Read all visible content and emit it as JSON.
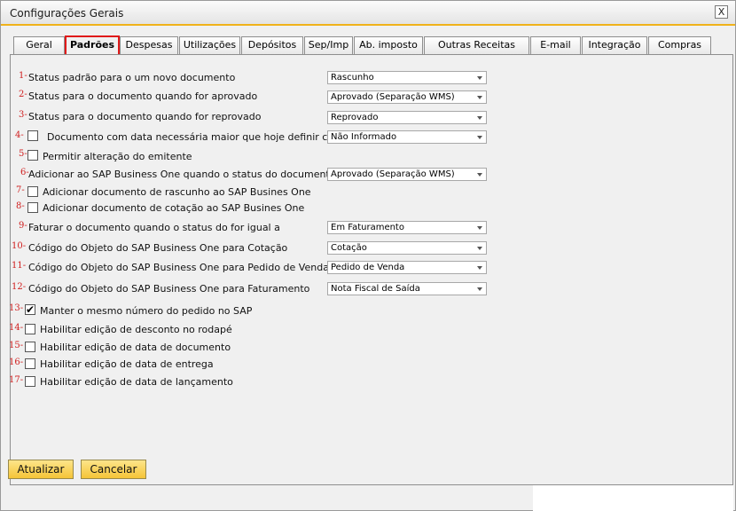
{
  "window": {
    "title": "Configurações Gerais",
    "close_label": "X"
  },
  "tabs": [
    {
      "label": "Geral"
    },
    {
      "label": "Padrões"
    },
    {
      "label": "Despesas"
    },
    {
      "label": "Utilizações"
    },
    {
      "label": "Depósitos"
    },
    {
      "label": "Sep/Imp"
    },
    {
      "label": "Ab. imposto"
    },
    {
      "label": "Outras Receitas"
    },
    {
      "label": "E-mail"
    },
    {
      "label": "Integração"
    },
    {
      "label": "Compras"
    }
  ],
  "rows": [
    {
      "num": "1-",
      "label": "Status padrão para o um novo documento",
      "value": "Rascunho"
    },
    {
      "num": "2-",
      "label": "Status para o documento quando for aprovado",
      "value": "Aprovado (Separação WMS)"
    },
    {
      "num": "3-",
      "label": "Status para o documento quando for reprovado",
      "value": "Reprovado"
    },
    {
      "num": "4-",
      "label": "Documento com data necessária maior que hoje definir como",
      "value": "Não Informado"
    },
    {
      "num": "5-",
      "label": "Permitir alteração do emitente"
    },
    {
      "num": "6-",
      "label": "Adicionar ao SAP Business One quando o status do documento for",
      "value": "Aprovado (Separação WMS)"
    },
    {
      "num": "7-",
      "label": "Adicionar documento de rascunho ao SAP Busines One"
    },
    {
      "num": "8-",
      "label": "Adicionar documento de cotação ao SAP Busines One"
    },
    {
      "num": "9-",
      "label": "Faturar o documento quando o status do for igual a",
      "value": "Em Faturamento"
    },
    {
      "num": "10-",
      "label": "Código do Objeto do SAP Business One para Cotação",
      "value": "Cotação"
    },
    {
      "num": "11-",
      "label": "Código do Objeto do SAP Business One para Pedido de Venda",
      "value": "Pedido de Venda"
    },
    {
      "num": "12-",
      "label": "Código do Objeto do SAP Business One para Faturamento",
      "value": "Nota Fiscal de Saída"
    },
    {
      "num": "13-",
      "label": "Manter o mesmo número do pedido no SAP",
      "check_mark": "✔"
    },
    {
      "num": "14-",
      "label": "Habilitar edição de desconto no rodapé"
    },
    {
      "num": "15-",
      "label": "Habilitar edição de data de documento"
    },
    {
      "num": "16-",
      "label": "Habilitar edição de data de entrega"
    },
    {
      "num": "17-",
      "label": "Habilitar edição de data de lançamento"
    }
  ],
  "buttons": {
    "update": "Atualizar",
    "cancel": "Cancelar"
  },
  "colors": {
    "accent": "#f0b21a",
    "annotation": "#d01f1f",
    "active_tab_outline": "#e01a1a",
    "button": "#f5c437"
  }
}
